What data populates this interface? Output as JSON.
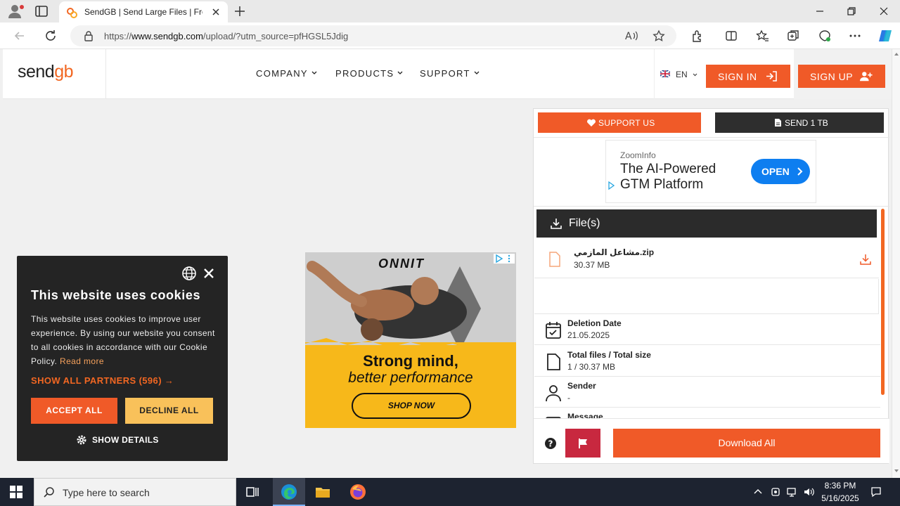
{
  "browser": {
    "tab_title": "SendGB | Send Large Files | Free fi",
    "url_host_prefix": "https://",
    "url_host": "www.sendgb.com",
    "url_path": "/upload/?utm_source=pfHGSL5Jdig"
  },
  "header": {
    "menu": [
      {
        "label": "COMPANY"
      },
      {
        "label": "PRODUCTS"
      },
      {
        "label": "SUPPORT"
      }
    ],
    "language": "EN",
    "sign_in": "SIGN IN",
    "sign_up": "SIGN UP"
  },
  "cookie": {
    "title": "This website uses cookies",
    "body": "This website uses cookies to improve user experience. By using our website you consent to all cookies in accordance with our Cookie Policy.",
    "read_more": "Read more",
    "partners": "SHOW ALL PARTNERS (596) →",
    "accept": "ACCEPT ALL",
    "decline": "DECLINE ALL",
    "details": "SHOW DETAILS"
  },
  "ad_middle": {
    "brand": "ONNIT",
    "line1": "Strong mind,",
    "line2": "better performance",
    "cta": "SHOP NOW"
  },
  "panel": {
    "support": "SUPPORT US",
    "send": "SEND 1 TB",
    "ad": {
      "brand": "ZoomInfo",
      "headline1": "The AI-Powered",
      "headline2": "GTM Platform",
      "cta": "OPEN"
    },
    "files_title": "File(s)",
    "file": {
      "name": "مشاعل المازمي.zip",
      "size": "30.37 MB"
    },
    "info": [
      {
        "label": "Deletion Date",
        "value": "21.05.2025"
      },
      {
        "label": "Total files / Total size",
        "value": "1 / 30.37 MB"
      },
      {
        "label": "Sender",
        "value": "-"
      },
      {
        "label": "Message",
        "value": ""
      }
    ],
    "download_all": "Download All"
  },
  "taskbar": {
    "search_placeholder": "Type here to search",
    "time": "8:36 PM",
    "date": "5/16/2025"
  },
  "colors": {
    "accent": "#f05a28",
    "dark": "#2b2b2b",
    "flag_red": "#c8283f",
    "ad_yellow": "#f7b81a",
    "ad_blue": "#0e7ef0"
  }
}
